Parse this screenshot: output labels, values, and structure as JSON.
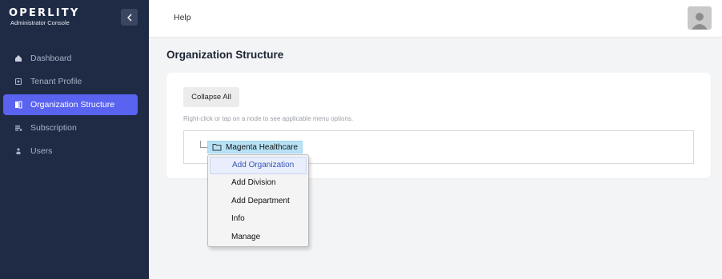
{
  "brand": {
    "name": "OPERLITY",
    "subtitle": "Administrator Console"
  },
  "sidebar": {
    "items": [
      {
        "label": "Dashboard",
        "icon": "home-icon",
        "active": false
      },
      {
        "label": "Tenant Profile",
        "icon": "profile-icon",
        "active": false
      },
      {
        "label": "Organization Structure",
        "icon": "structure-icon",
        "active": true
      },
      {
        "label": "Subscription",
        "icon": "subscription-icon",
        "active": false
      },
      {
        "label": "Users",
        "icon": "users-icon",
        "active": false
      }
    ]
  },
  "header": {
    "help_label": "Help"
  },
  "main": {
    "title": "Organization Structure",
    "collapse_all_label": "Collapse All",
    "hint": "Right-click or tap on a node to see applicable menu options.",
    "tree": {
      "root_label": "Magenta Healthcare"
    }
  },
  "context_menu": {
    "items": [
      "Add Organization",
      "Add Division",
      "Add Department",
      "Info",
      "Manage"
    ],
    "highlighted": "Add Organization"
  },
  "colors": {
    "sidebar_bg": "#1f2b45",
    "active_nav": "#5a63f0",
    "node_highlight": "#b8e3f7"
  }
}
